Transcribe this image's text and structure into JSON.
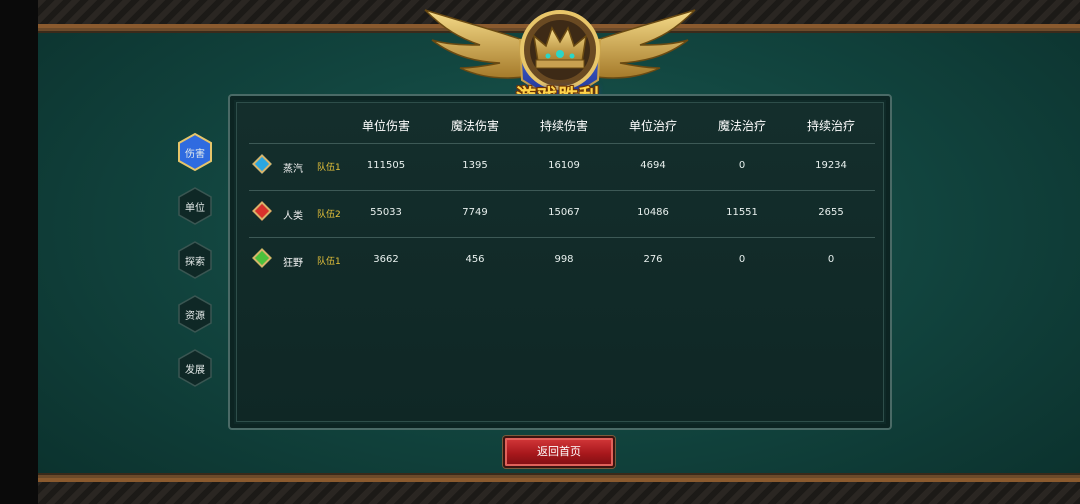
{
  "emblem": {
    "title": "游戏胜利"
  },
  "tabs": [
    {
      "label": "伤害",
      "active": true
    },
    {
      "label": "单位",
      "active": false
    },
    {
      "label": "探索",
      "active": false
    },
    {
      "label": "资源",
      "active": false
    },
    {
      "label": "发展",
      "active": false
    }
  ],
  "table": {
    "headers": [
      "单位伤害",
      "魔法伤害",
      "持续伤害",
      "单位治疗",
      "魔法治疗",
      "持续治疗"
    ],
    "rows": [
      {
        "gem": "blue-gem-icon",
        "gem_color": "#2aa6e0",
        "name": "蒸汽",
        "team": "队伍1",
        "values": [
          "111505",
          "1395",
          "16109",
          "4694",
          "0",
          "19234"
        ]
      },
      {
        "gem": "red-gem-icon",
        "gem_color": "#d8322c",
        "name": "人类",
        "team": "队伍2",
        "values": [
          "55033",
          "7749",
          "15067",
          "10486",
          "11551",
          "2655"
        ]
      },
      {
        "gem": "green-gem-icon",
        "gem_color": "#4cc23c",
        "name": "狂野",
        "team": "队伍1",
        "values": [
          "3662",
          "456",
          "998",
          "276",
          "0",
          "0"
        ]
      }
    ]
  },
  "footer": {
    "home_button": "返回首页"
  },
  "colors": {
    "team_label": "#e6c23a",
    "active_tab": "#2f6be0",
    "button": "#b51e22"
  }
}
